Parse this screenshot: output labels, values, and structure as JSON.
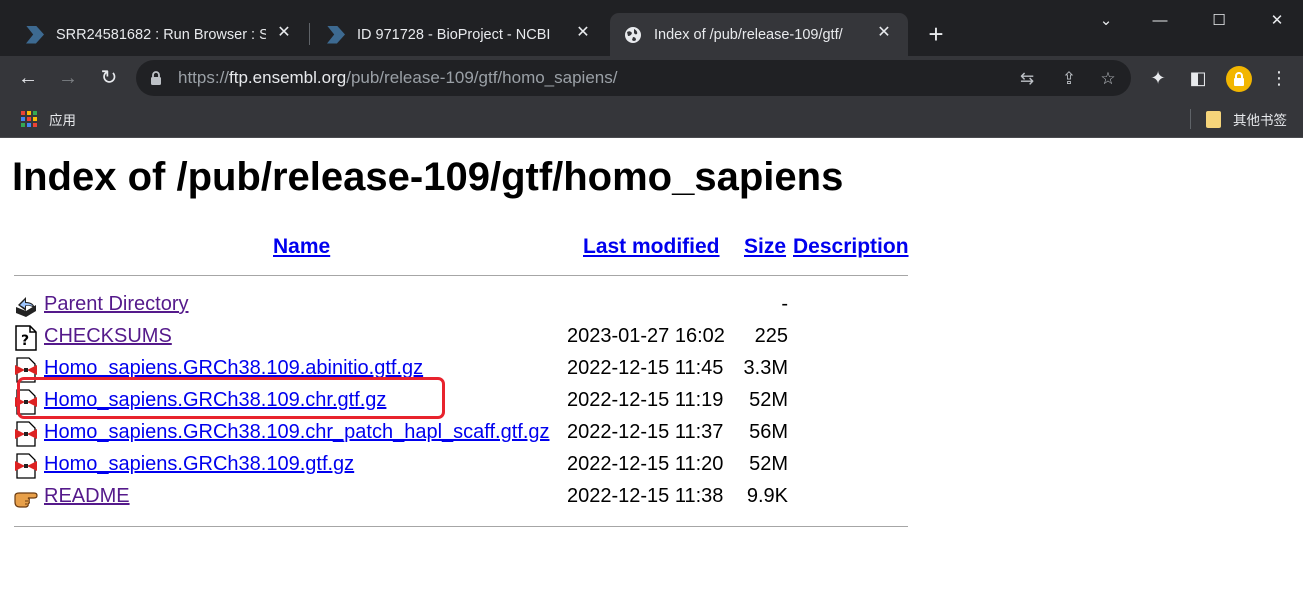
{
  "tabs": [
    {
      "title": "SRR24581682 : Run Browser : S",
      "icon": "ncbi-icon"
    },
    {
      "title": "ID 971728 - BioProject - NCBI",
      "icon": "ncbi-icon"
    },
    {
      "title": "Index of /pub/release-109/gtf/",
      "icon": "globe-icon",
      "active": true
    }
  ],
  "omnibox": {
    "scheme": "https://",
    "host": "ftp.ensembl.org",
    "path": "/pub/release-109/gtf/homo_sapiens/"
  },
  "bookmarks": {
    "apps_label": "应用",
    "other_label": "其他书签"
  },
  "page": {
    "heading": "Index of /pub/release-109/gtf/homo_sapiens",
    "columns": {
      "name": "Name",
      "last_modified": "Last modified",
      "size": "Size",
      "description": "Description"
    },
    "rows": [
      {
        "name": "Parent Directory",
        "date": "",
        "size": "-",
        "icon": "back-folder-icon",
        "visited": true
      },
      {
        "name": "CHECKSUMS",
        "date": "2023-01-27 16:02",
        "size": "225",
        "icon": "unknown-file-icon",
        "visited": true
      },
      {
        "name": "Homo_sapiens.GRCh38.109.abinitio.gtf.gz",
        "date": "2022-12-15 11:45",
        "size": "3.3M",
        "icon": "compressed-file-icon",
        "visited": false
      },
      {
        "name": "Homo_sapiens.GRCh38.109.chr.gtf.gz",
        "date": "2022-12-15 11:19",
        "size": "52M",
        "icon": "compressed-file-icon",
        "visited": false
      },
      {
        "name": "Homo_sapiens.GRCh38.109.chr_patch_hapl_scaff.gtf.gz",
        "date": "2022-12-15 11:37",
        "size": "56M",
        "icon": "compressed-file-icon",
        "visited": false
      },
      {
        "name": "Homo_sapiens.GRCh38.109.gtf.gz",
        "date": "2022-12-15 11:20",
        "size": "52M",
        "icon": "compressed-file-icon",
        "visited": false
      },
      {
        "name": "README",
        "date": "2022-12-15 11:38",
        "size": "9.9K",
        "icon": "hand-pointing-icon",
        "visited": true
      }
    ],
    "highlight_color": "#e8232d",
    "link_color": "#0000ee",
    "visited_color": "#551a8b"
  }
}
